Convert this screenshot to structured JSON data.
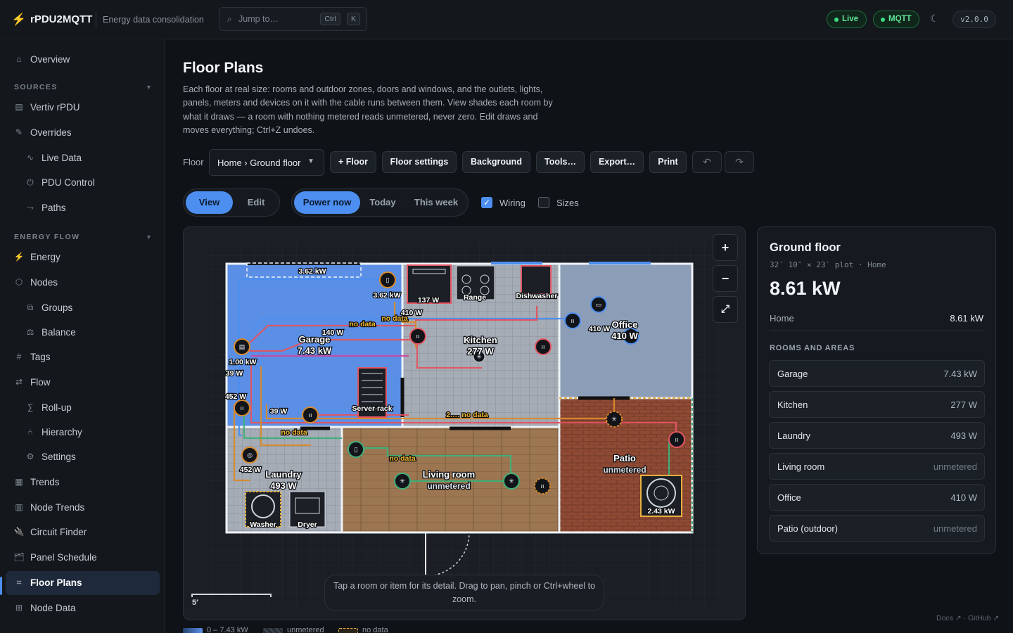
{
  "app": {
    "name": "rPDU2MQTT",
    "subtitle": "Energy data consolidation",
    "jump_placeholder": "Jump to…",
    "kbd_ctrl": "Ctrl",
    "kbd_k": "K",
    "status_live": "Live",
    "status_mqtt": "MQTT",
    "theme_icon": "☾",
    "version": "v2.0.0",
    "accent_color": "#4d8ff0"
  },
  "sidebar": {
    "overview": "Overview",
    "sources_heading": "SOURCES",
    "sources": [
      "Vertiv rPDU",
      "Overrides",
      "Live Data",
      "PDU Control",
      "Paths"
    ],
    "energy_heading": "ENERGY FLOW",
    "energy": [
      "Energy",
      "Nodes",
      "Groups",
      "Balance",
      "Tags",
      "Flow",
      "Roll-up",
      "Hierarchy",
      "Settings",
      "Trends",
      "Node Trends",
      "Circuit Finder",
      "Panel Schedule",
      "Floor Plans",
      "Node Data"
    ]
  },
  "page": {
    "title": "Floor Plans",
    "description": "Each floor at real size: rooms and outdoor zones, doors and windows, and the outlets, lights, panels, meters and devices on it with the cable runs between them. View shades each room by what it draws — a room with nothing metered reads unmetered, never zero. Edit draws and moves everything; Ctrl+Z undoes."
  },
  "toolbar": {
    "floor_label": "Floor",
    "floor_value": "Home › Ground floor",
    "add_floor": "+ Floor",
    "floor_settings": "Floor settings",
    "background": "Background",
    "tools": "Tools…",
    "export": "Export…",
    "print": "Print",
    "undo_icon": "↶",
    "redo_icon": "↷"
  },
  "modes": {
    "view": "View",
    "edit": "Edit",
    "power_now": "Power now",
    "today": "Today",
    "this_week": "This week",
    "wiring": "Wiring",
    "sizes": "Sizes",
    "wiring_checked": true,
    "sizes_checked": false
  },
  "canvas": {
    "zoom_in": "+",
    "zoom_out": "−",
    "fit": "⤢",
    "scale_label": "5′",
    "hint": "Tap a room or item for its detail. Drag to pan, pinch or Ctrl+wheel to zoom.",
    "rooms": {
      "garage": {
        "name": "Garage",
        "value": "7.43 kW"
      },
      "kitchen": {
        "name": "Kitchen",
        "value": "277 W"
      },
      "office": {
        "name": "Office",
        "value": "410 W"
      },
      "laundry": {
        "name": "Laundry",
        "value": "493 W"
      },
      "living": {
        "name": "Living room",
        "value": "unmetered"
      },
      "patio": {
        "name": "Patio",
        "value": "unmetered"
      }
    },
    "labels": {
      "garage_top": "3.62 kW",
      "panel_ev": "3.62 kW",
      "oven": "137 W",
      "range": "Range",
      "dishwasher": "Dishwasher",
      "k_410": "410 W",
      "nodata1": "no data",
      "nodata2": "no data",
      "w140": "140 W",
      "g_100": "1.00 kW",
      "g_39": "39 W",
      "g_452": "452 W",
      "g_39b": "39 W",
      "server_rack": "Server rack",
      "nodata3": "no data",
      "nodata_hall": "2.… no data",
      "office_410": "410 W",
      "laundry_452": "452 W",
      "washer": "Washer",
      "dryer": "Dryer",
      "living_nodata": "no data",
      "patio_ac": "2.43 kW"
    }
  },
  "legend": {
    "range": "0 – 7.43 kW",
    "unmetered": "unmetered",
    "nodata": "no data"
  },
  "panel": {
    "title": "Ground floor",
    "plot": "32′ 10″ × 23′ plot · Home",
    "total": "8.61 kW",
    "home_label": "Home",
    "home_value": "8.61 kW",
    "section": "ROOMS AND AREAS",
    "rooms": [
      {
        "name": "Garage",
        "value": "7.43 kW"
      },
      {
        "name": "Kitchen",
        "value": "277 W"
      },
      {
        "name": "Laundry",
        "value": "493 W"
      },
      {
        "name": "Living room",
        "value": "unmetered"
      },
      {
        "name": "Office",
        "value": "410 W"
      },
      {
        "name": "Patio (outdoor)",
        "value": "unmetered"
      }
    ]
  },
  "footer": {
    "links": "Docs ↗ · GitHub ↗"
  }
}
